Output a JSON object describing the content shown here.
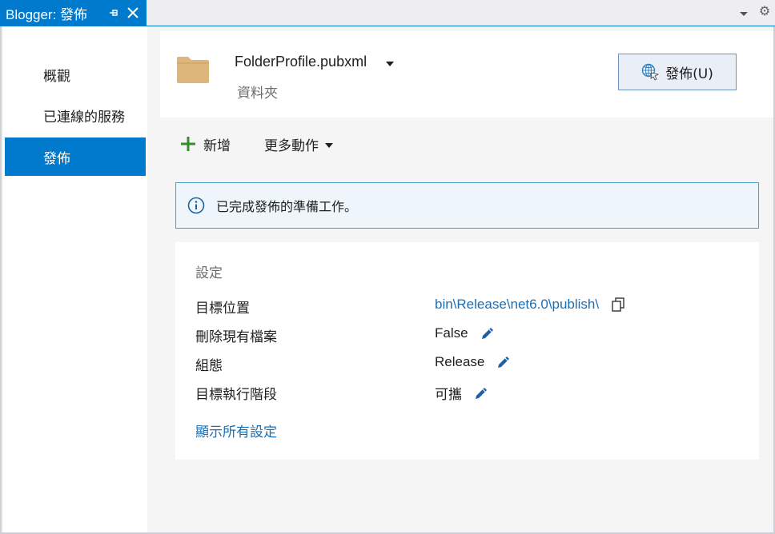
{
  "tab": {
    "title": "Blogger: 發佈"
  },
  "sidebar": {
    "items": [
      {
        "label": "概觀"
      },
      {
        "label": "已連線的服務"
      },
      {
        "label": "發佈"
      }
    ]
  },
  "profile": {
    "name": "FolderProfile.pubxml",
    "type": "資料夾",
    "publish_label": "發佈(U)"
  },
  "toolbar": {
    "add_label": "新增",
    "more_label": "更多動作"
  },
  "info": {
    "message": "已完成發佈的準備工作。"
  },
  "settings": {
    "title": "設定",
    "rows": [
      {
        "label": "目標位置",
        "value": "bin\\Release\\net6.0\\publish\\"
      },
      {
        "label": "刪除現有檔案",
        "value": "False"
      },
      {
        "label": "組態",
        "value": "Release"
      },
      {
        "label": "目標執行階段",
        "value": "可攜"
      }
    ],
    "show_all": "顯示所有設定"
  },
  "colors": {
    "accent": "#007acc",
    "link": "#1a6fb5",
    "add_green": "#388a34",
    "edit_blue": "#1e5fa8",
    "folder": "#dcb67a"
  },
  "icons": [
    "pin-icon",
    "close-icon",
    "dropdown-icon",
    "gear-icon",
    "folder-icon",
    "globe-icon",
    "plus-icon",
    "info-icon",
    "copy-icon",
    "pencil-icon"
  ]
}
